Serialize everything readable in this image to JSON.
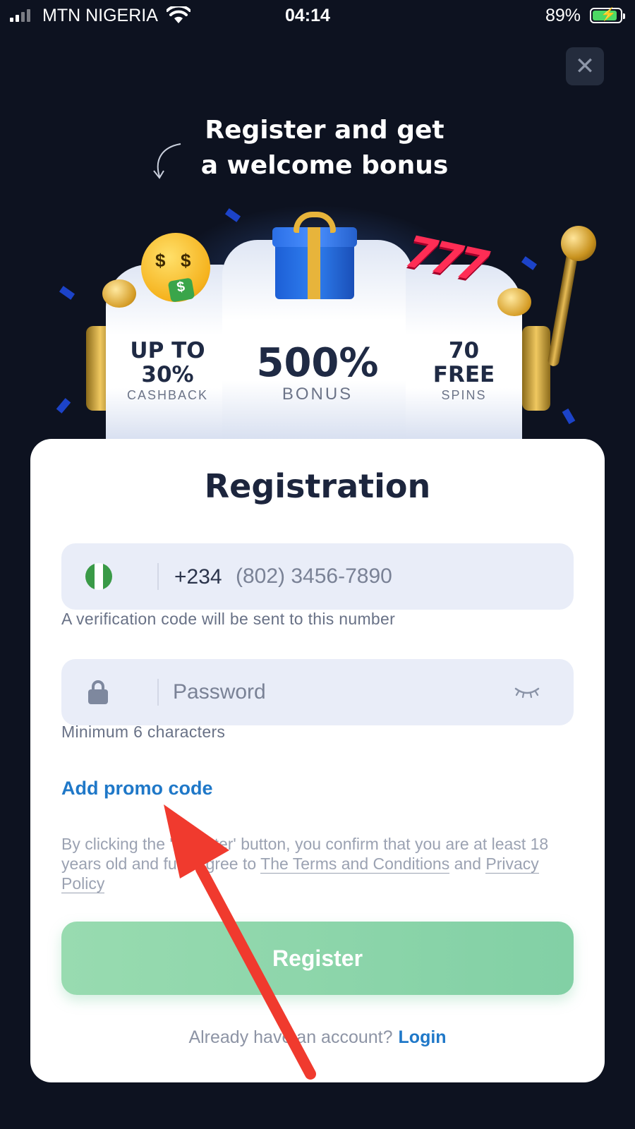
{
  "status_bar": {
    "carrier": "MTN NIGERIA",
    "time": "04:14",
    "battery_percent": "89%",
    "battery_level": 0.89
  },
  "promo": {
    "title_line1": "Register and get",
    "title_line2": "a welcome bonus",
    "reels": {
      "left": {
        "line1": "UP TO",
        "line2": "30%",
        "caption": "CASHBACK"
      },
      "center": {
        "value": "500%",
        "caption": "BONUS"
      },
      "right": {
        "line1": "70",
        "line2": "FREE",
        "caption": "SPINS"
      }
    }
  },
  "form": {
    "title": "Registration",
    "phone": {
      "country_code": "+234",
      "placeholder": "(802) 3456-7890",
      "helper": "A verification code will be sent to this number"
    },
    "password": {
      "placeholder": "Password",
      "helper": "Minimum 6 characters"
    },
    "promo_link": "Add promo code",
    "terms": {
      "text_before": "By clicking the 'Register' button, you confirm that you are at least 18 years old and fully agree to ",
      "terms_link": "The Terms and Conditions",
      "text_and": " and ",
      "privacy_link": "Privacy Policy"
    },
    "register_button": "Register",
    "login_prompt": "Already have an account?",
    "login_link": "Login"
  },
  "icons": {
    "close": "close-icon",
    "wifi": "wifi-icon",
    "lock": "lock-icon",
    "eye": "eye-closed-icon",
    "flag": "nigeria-flag-icon"
  },
  "colors": {
    "background": "#0d1220",
    "accent_link": "#1f78c8",
    "register_button": "#8fd6ab",
    "field_background": "#e9edf8",
    "annotation_arrow": "#f03a2e"
  }
}
